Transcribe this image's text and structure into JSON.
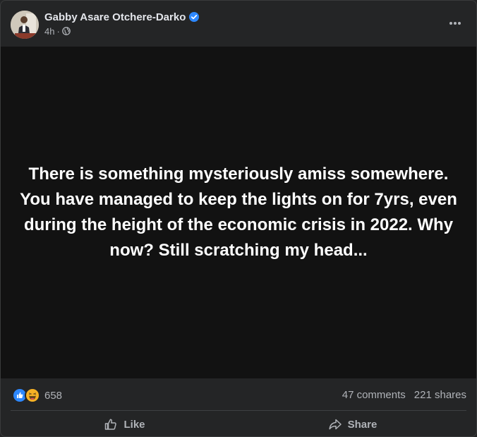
{
  "post": {
    "author": "Gabby Asare Otchere-Darko",
    "time": "4h",
    "separator": "·",
    "text": "There is something mysteriously amiss somewhere. You have managed to keep the lights on for 7yrs, even during the height of the economic crisis in 2022. Why now? Still scratching my head...",
    "background_color": "#121212"
  },
  "icons": {
    "verified": "verified-badge-icon",
    "audience": "globe-icon",
    "more": "more-options-icon",
    "reactions": [
      "like-reaction-icon",
      "haha-reaction-icon"
    ],
    "like": "thumbs-up-icon",
    "share": "share-arrow-icon"
  },
  "stats": {
    "reaction_count": "658",
    "comments": "47 comments",
    "shares": "221 shares"
  },
  "actions": {
    "like_label": "Like",
    "share_label": "Share"
  },
  "colors": {
    "card_bg": "#242526",
    "accent_blue": "#2d88ff",
    "secondary_text": "#b0b3b8"
  }
}
